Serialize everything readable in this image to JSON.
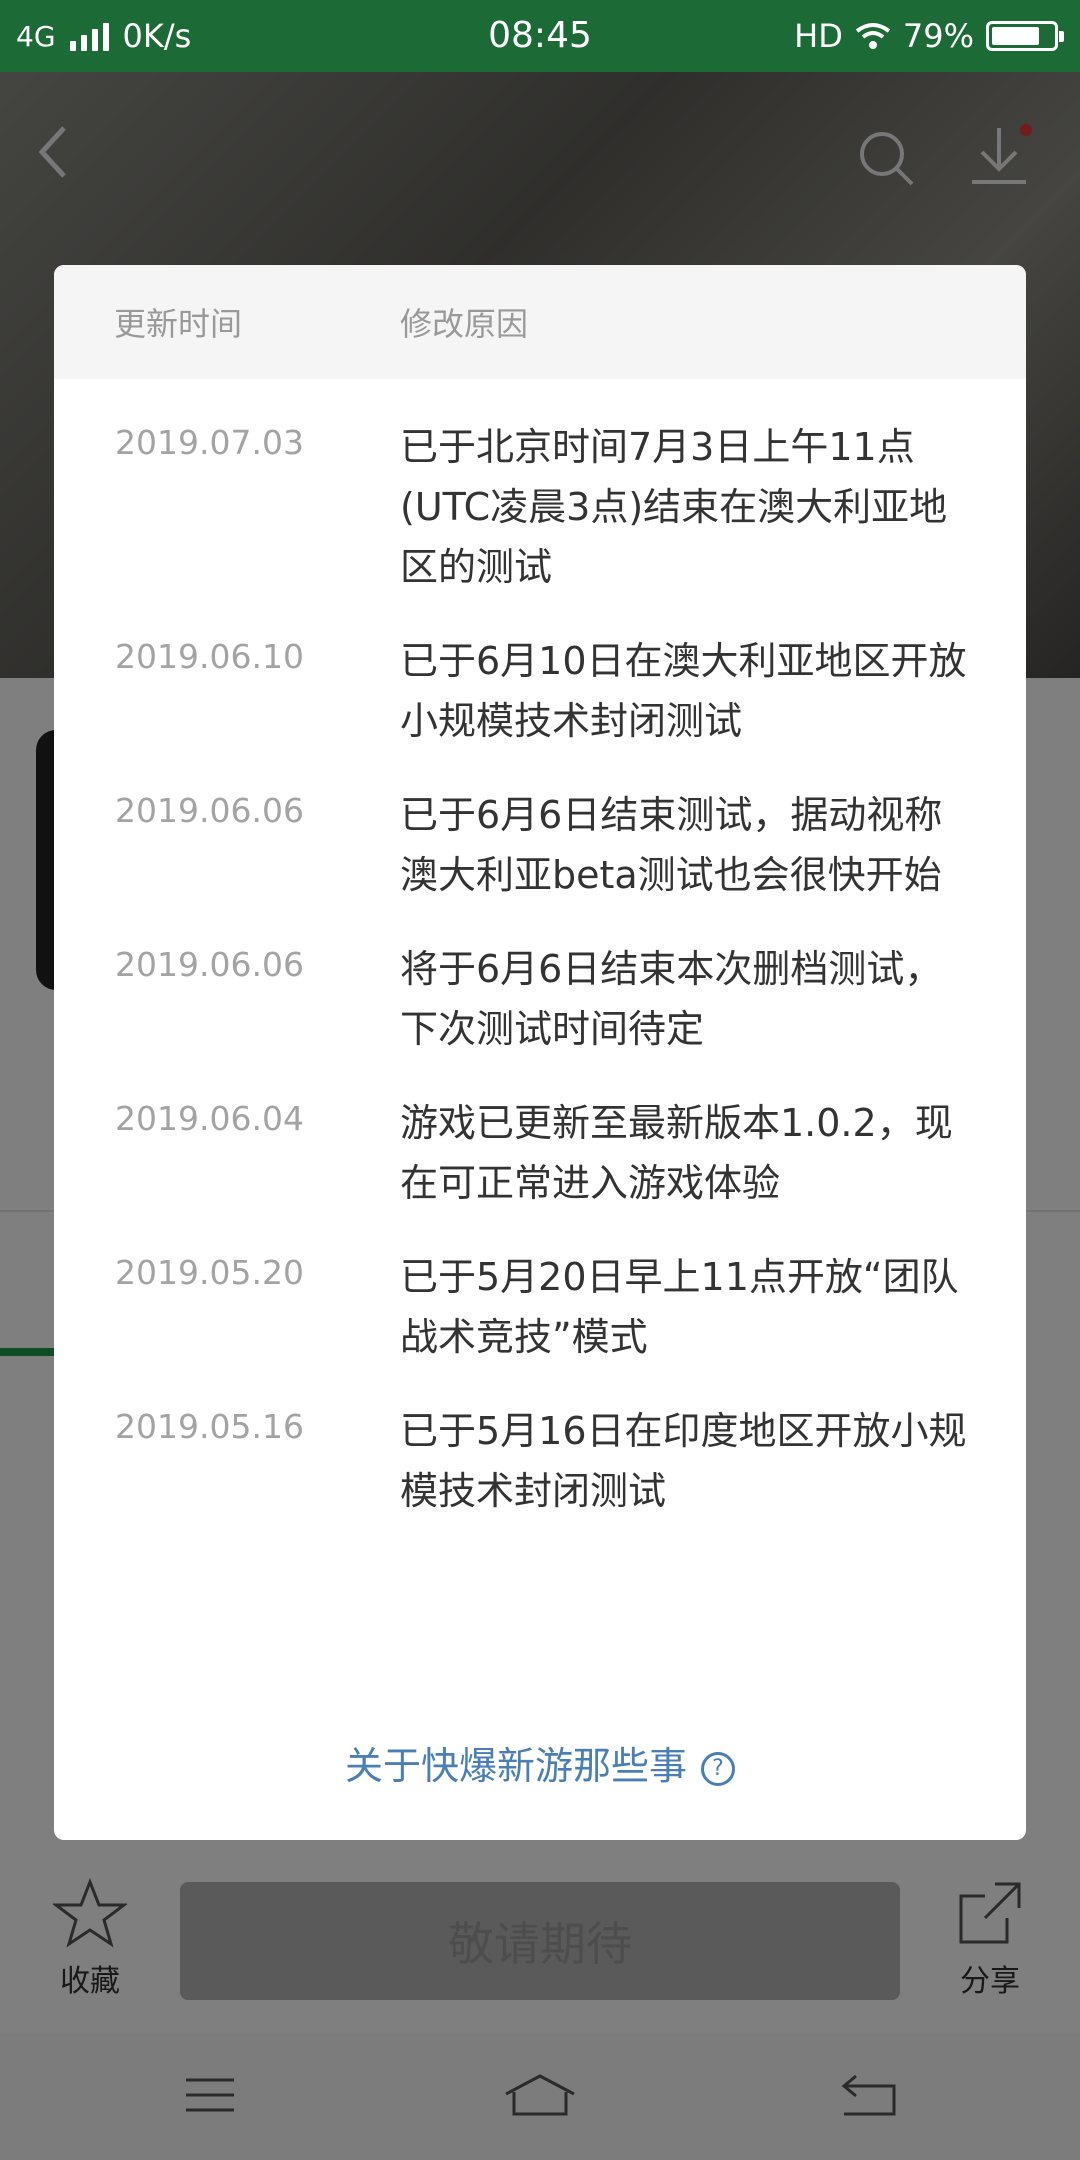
{
  "status_bar": {
    "network": "4G",
    "speed": "0K/s",
    "time": "08:45",
    "hd": "HD",
    "battery_percent": "79%",
    "battery_level": 0.79
  },
  "bottom_bar": {
    "favorite_label": "收藏",
    "main_button_label": "敬请期待",
    "share_label": "分享"
  },
  "dialog": {
    "header": {
      "time_col": "更新时间",
      "reason_col": "修改原因"
    },
    "entries": [
      {
        "date": "2019.07.03",
        "text": "已于北京时间7月3日上午11点(UTC凌晨3点)结束在澳大利亚地区的测试"
      },
      {
        "date": "2019.06.10",
        "text": "已于6月10日在澳大利亚地区开放小规模技术封闭测试"
      },
      {
        "date": "2019.06.06",
        "text": "已于6月6日结束测试，据动视称澳大利亚beta测试也会很快开始"
      },
      {
        "date": "2019.06.06",
        "text": "将于6月6日结束本次删档测试，下次测试时间待定"
      },
      {
        "date": "2019.06.04",
        "text": "游戏已更新至最新版本1.0.2，现在可正常进入游戏体验"
      },
      {
        "date": "2019.05.20",
        "text": "已于5月20日早上11点开放“团队战术竞技”模式"
      },
      {
        "date": "2019.05.16",
        "text": "已于5月16日在印度地区开放小规模技术封闭测试"
      }
    ],
    "footer_link": "关于快爆新游那些事",
    "help_symbol": "?"
  },
  "icons": {
    "back": "back-arrow-icon",
    "search": "search-icon",
    "download": "download-icon",
    "favorite": "star-icon",
    "share": "share-icon",
    "menu": "menu-icon",
    "home": "home-icon",
    "return": "return-icon"
  }
}
